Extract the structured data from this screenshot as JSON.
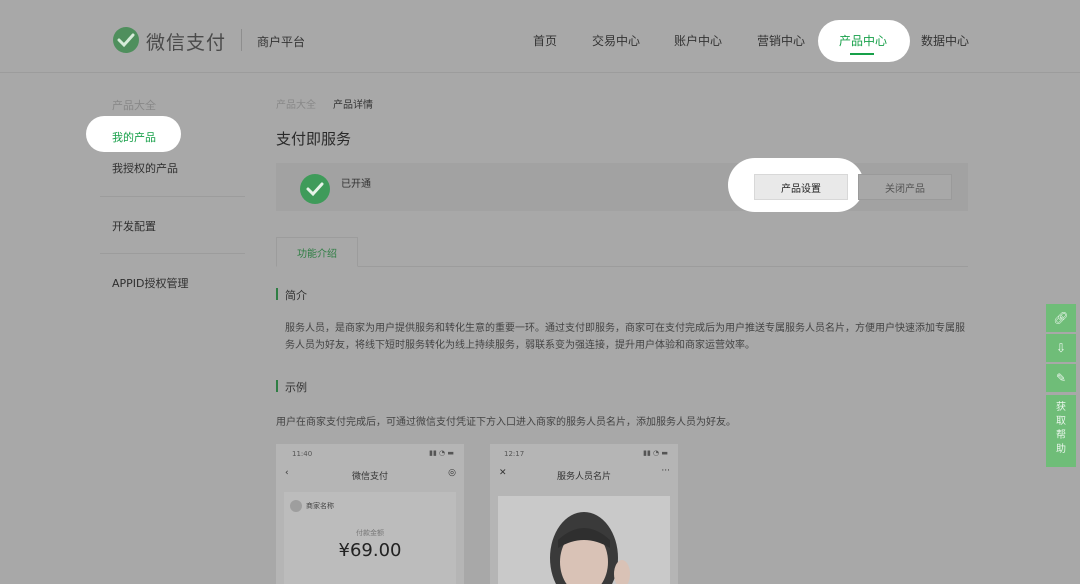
{
  "header": {
    "logo_text": "微信支付",
    "platform": "商户平台",
    "nav": [
      "首页",
      "交易中心",
      "账户中心",
      "营销中心",
      "产品中心",
      "数据中心"
    ],
    "active_nav": "产品中心",
    "accent": "#17a049"
  },
  "sidebar": {
    "group": "产品大全",
    "items": [
      "我的产品",
      "我授权的产品",
      "开发配置",
      "APPID授权管理"
    ]
  },
  "breadcrumb": [
    "产品大全",
    "产品详情"
  ],
  "page_title": "支付即服务",
  "status_card": {
    "status": "已开通",
    "set_button": "产品设置",
    "close_button": "关闭产品"
  },
  "tab": "功能介绍",
  "intro": {
    "title": "简介",
    "text": "服务人员，是商家为用户提供服务和转化生意的重要一环。通过支付即服务，商家可在支付完成后为用户推送专属服务人员名片，方便用户快速添加专属服务人员为好友，将线下短时服务转化为线上持续服务，弱联系变为强连接，提升用户体验和商家运营效率。"
  },
  "example": {
    "title": "示例",
    "text": "用户在商家支付完成后，可通过微信支付凭证下方入口进入商家的服务人员名片，添加服务人员为好友。"
  },
  "phone1": {
    "time": "11:40",
    "title": "微信支付",
    "merchant": "商家名称",
    "amount_label": "付款金额",
    "amount": "¥69.00"
  },
  "phone2": {
    "time": "12:17",
    "title": "服务人员名片"
  },
  "float": {
    "help": "获取帮助"
  }
}
